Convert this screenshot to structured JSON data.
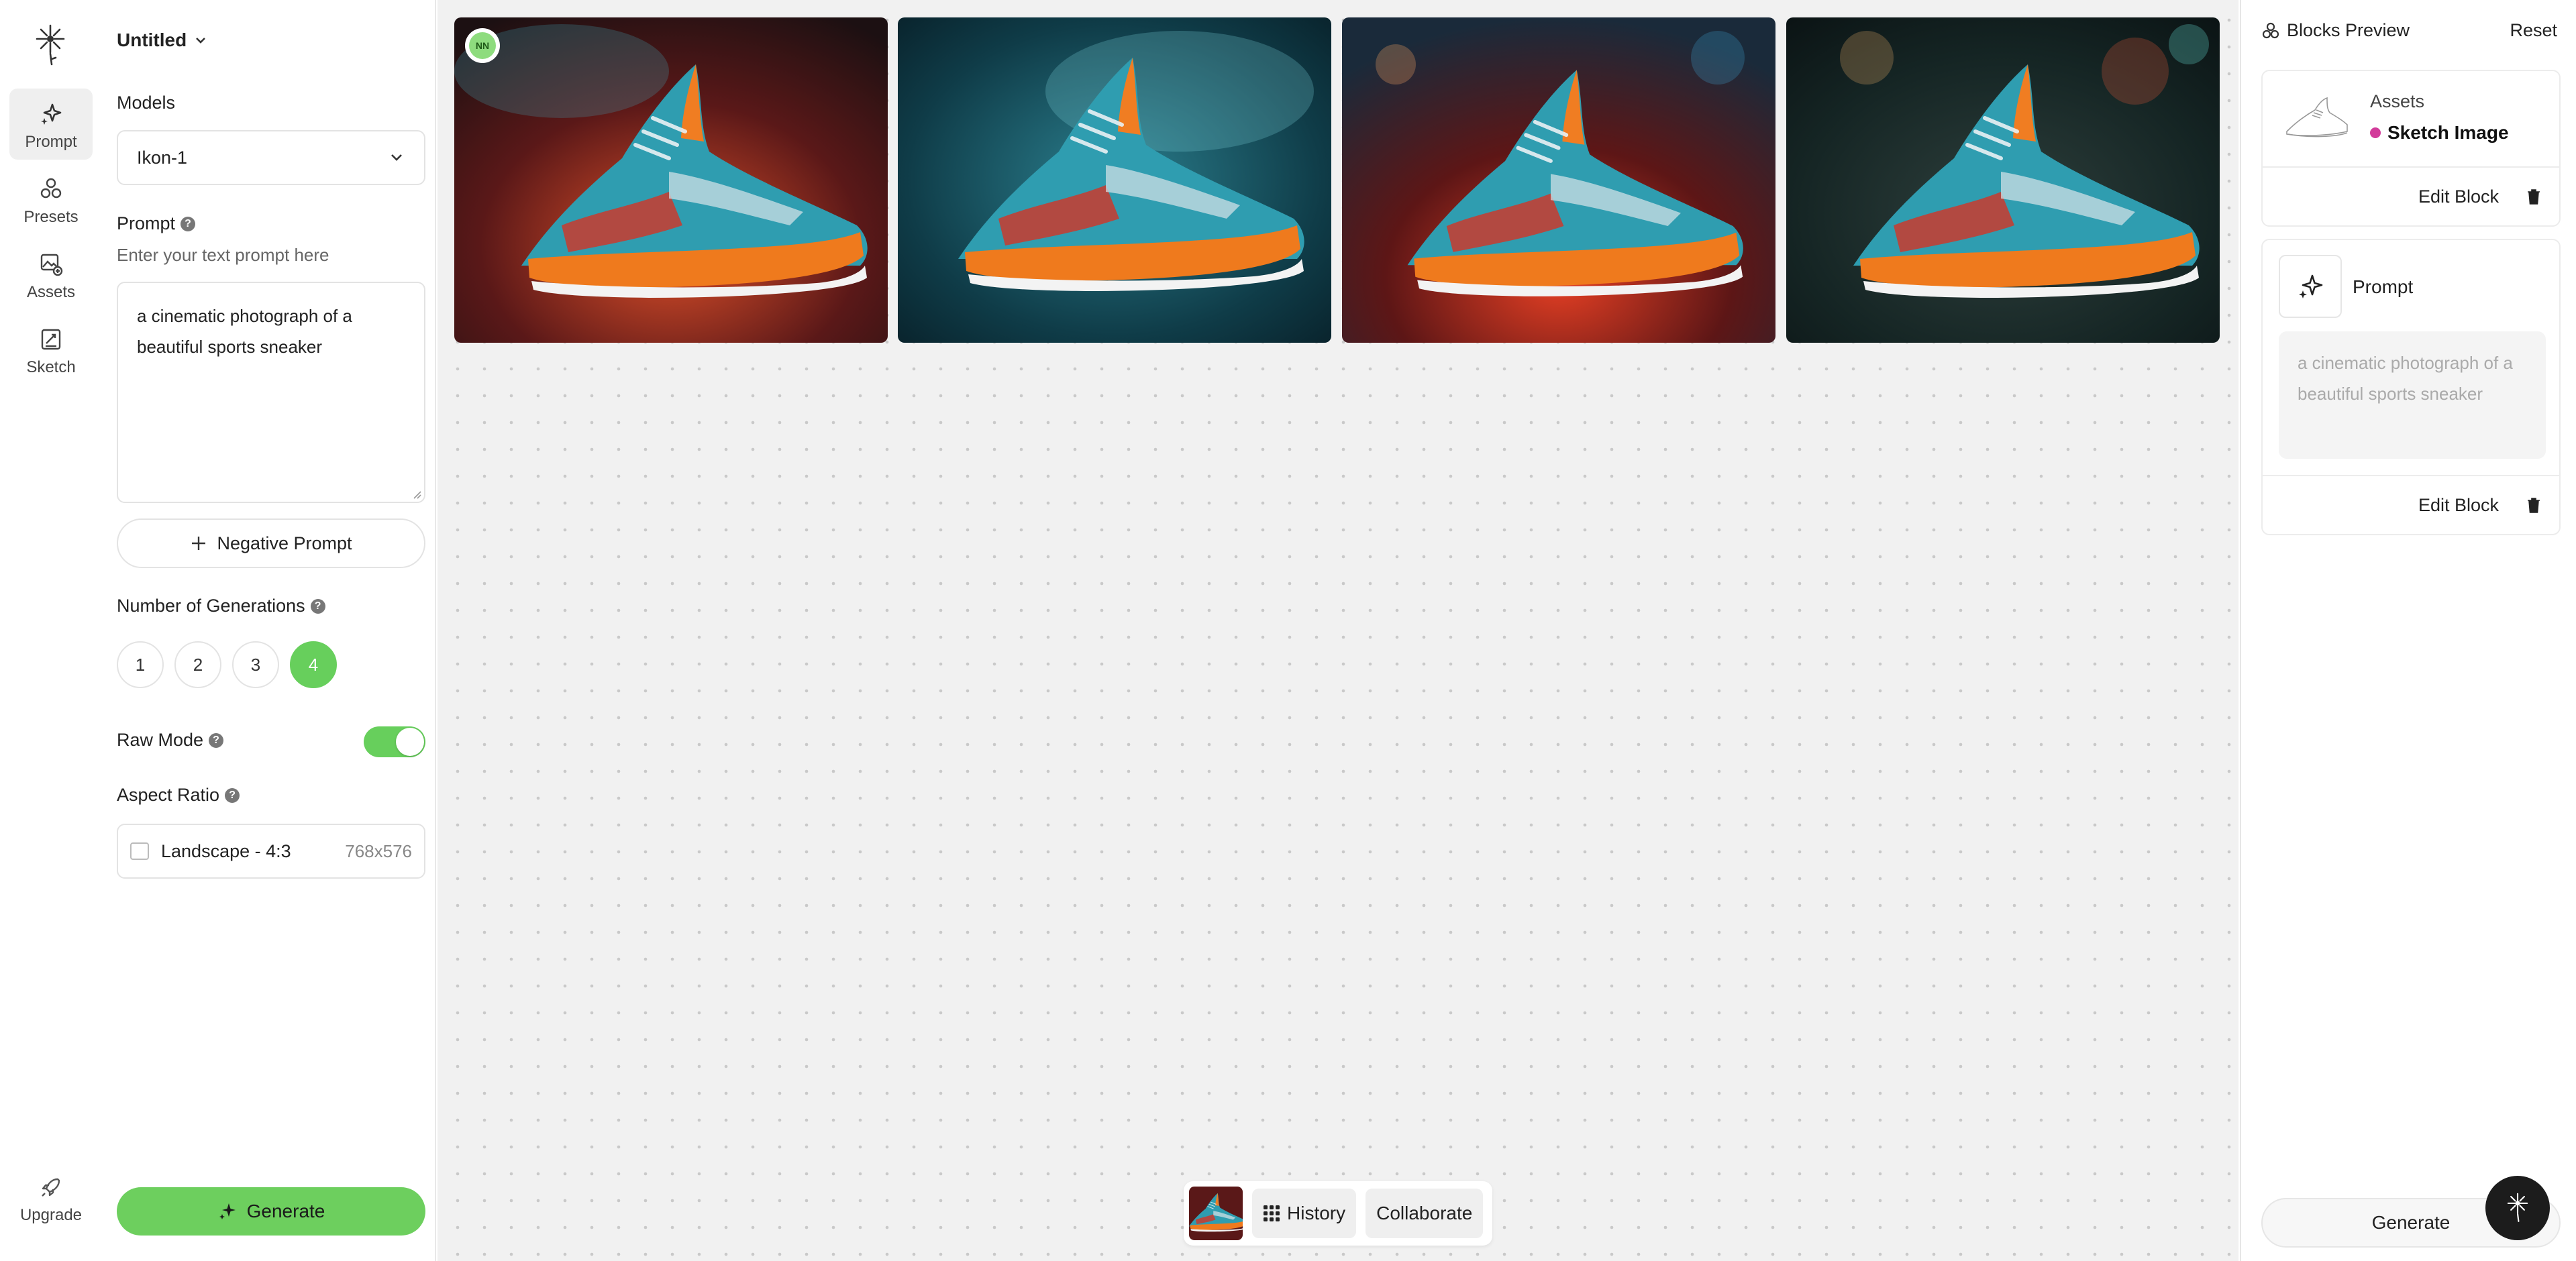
{
  "project": {
    "title": "Untitled"
  },
  "rail": {
    "items": [
      {
        "label": "Prompt",
        "icon": "sparkle-icon"
      },
      {
        "label": "Presets",
        "icon": "presets-icon"
      },
      {
        "label": "Assets",
        "icon": "assets-icon"
      },
      {
        "label": "Sketch",
        "icon": "sketch-icon"
      }
    ],
    "upgrade": "Upgrade"
  },
  "panel": {
    "models_label": "Models",
    "model_value": "Ikon-1",
    "prompt_label": "Prompt",
    "prompt_sub": "Enter your text prompt here",
    "prompt_text": "a cinematic photograph of a beautiful sports sneaker",
    "negative_prompt": "Negative Prompt",
    "generations_label": "Number of Generations",
    "generations": [
      "1",
      "2",
      "3",
      "4"
    ],
    "generations_selected": "4",
    "raw_mode_label": "Raw Mode",
    "raw_mode_on": true,
    "aspect_label": "Aspect Ratio",
    "aspect_value": "Landscape - 4:3",
    "aspect_dims": "768x576",
    "generate": "Generate"
  },
  "canvas": {
    "avatar_initials": "NN",
    "history": "History",
    "collaborate": "Collaborate"
  },
  "right": {
    "title": "Blocks Preview",
    "reset": "Reset",
    "assets_label": "Assets",
    "sketch_image": "Sketch Image",
    "edit_block": "Edit Block",
    "prompt_label": "Prompt",
    "prompt_preview": "a cinematic photograph of a beautiful sports sneaker",
    "generate": "Generate"
  },
  "colors": {
    "accent": "#67cf5c",
    "asset_dot": "#d23b9a"
  }
}
